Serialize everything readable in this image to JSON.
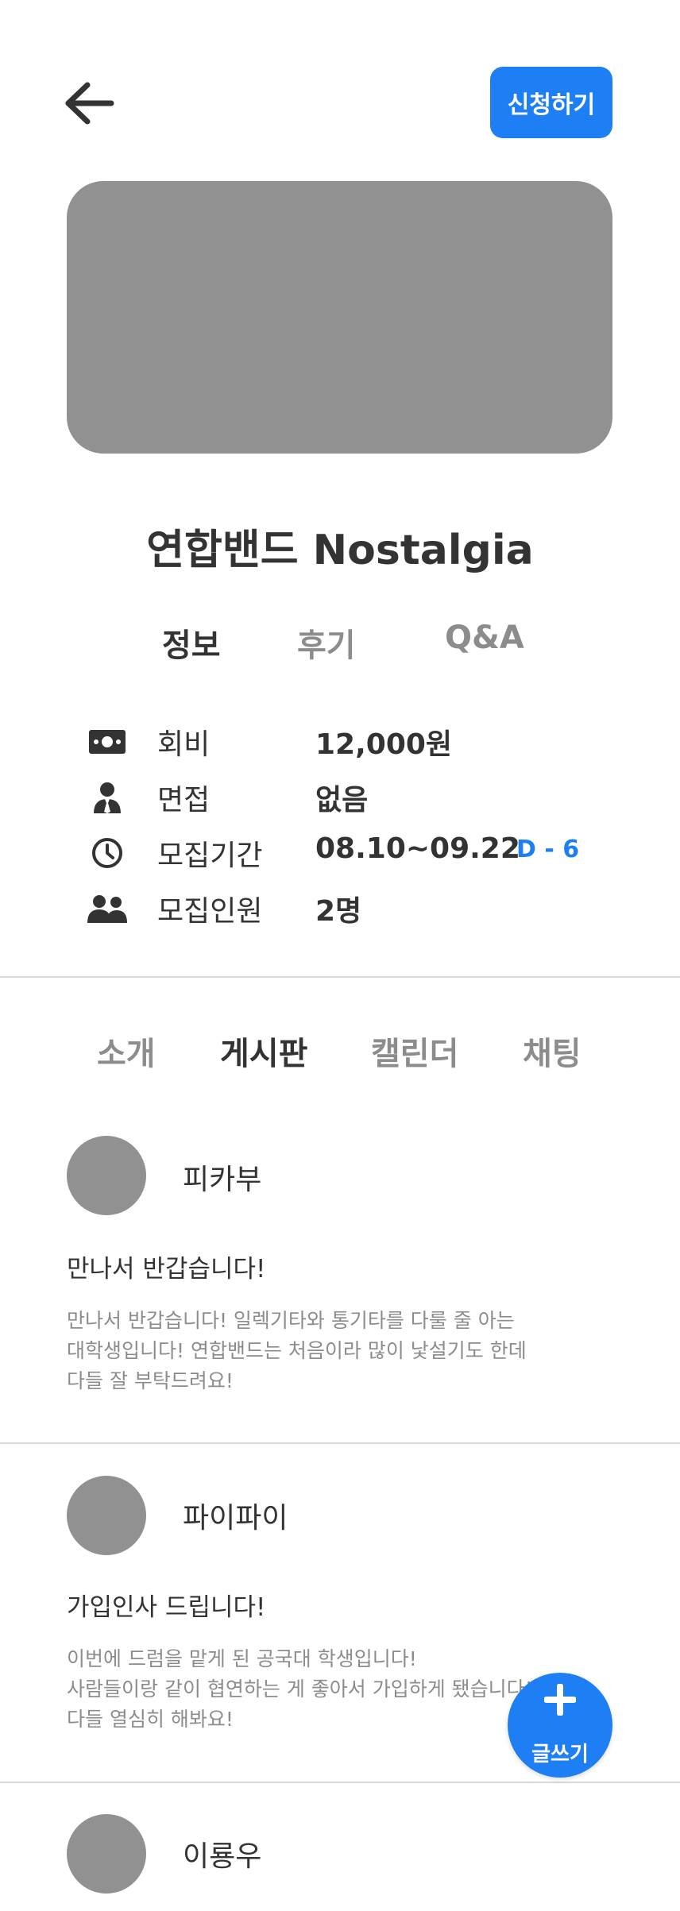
{
  "header": {
    "back_icon": "arrow-left-icon",
    "apply_label": "신청하기"
  },
  "group": {
    "title": "연합밴드 Nostalgia"
  },
  "top_tabs": [
    {
      "label": "정보",
      "active": true
    },
    {
      "label": "후기",
      "active": false
    },
    {
      "label": "Q&A",
      "active": false
    }
  ],
  "info": [
    {
      "icon": "money-icon",
      "label": "회비",
      "value": "12,000원"
    },
    {
      "icon": "person-icon",
      "label": "면접",
      "value": "없음"
    },
    {
      "icon": "clock-icon",
      "label": "모집기간",
      "value": "08.10~09.22",
      "badge": "D - 6"
    },
    {
      "icon": "people-icon",
      "label": "모집인원",
      "value": "2명"
    }
  ],
  "sub_tabs": [
    {
      "label": "소개",
      "active": false
    },
    {
      "label": "게시판",
      "active": true
    },
    {
      "label": "캘린더",
      "active": false
    },
    {
      "label": "채팅",
      "active": false
    }
  ],
  "posts": [
    {
      "author": "피카부",
      "title": "만나서 반갑습니다!",
      "body": [
        "만나서 반갑습니다! 일렉기타와 통기타를 다룰 줄 아는",
        "대학생입니다! 연합밴드는 처음이라 많이 낯설기도 한데",
        "다들 잘 부탁드려요!"
      ]
    },
    {
      "author": "파이파이",
      "title": "가입인사 드립니다!",
      "body": [
        "이번에 드럼을 맡게 된 공국대 학생입니다!",
        "사람들이랑 같이 협연하는 게 좋아서 가입하게 됐습니다!",
        "다들 열심히 해봐요!"
      ]
    },
    {
      "author": "이룡우"
    }
  ],
  "fab": {
    "icon": "plus-icon",
    "label": "글쓰기"
  },
  "colors": {
    "accent": "#1e7ff5",
    "text": "#333333",
    "muted": "#8c8c8c",
    "placeholder": "#919191"
  }
}
